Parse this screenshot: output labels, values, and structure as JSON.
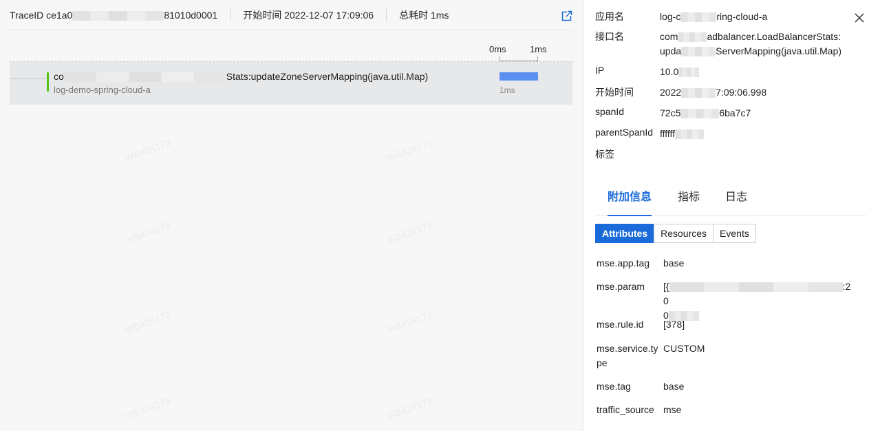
{
  "header": {
    "trace_label": "TraceID",
    "trace_prefix": "ce1a0",
    "trace_suffix": "81010d0001",
    "start_label": "开始时间",
    "start_value": "2022-12-07 17:09:06",
    "total_label": "总耗时",
    "total_value": "1ms"
  },
  "timeline": {
    "scale_start": "0ms",
    "scale_end": "1ms",
    "span": {
      "name_prefix": "co",
      "name_suffix": "Stats:updateZoneServerMapping(java.util.Map)",
      "service": "log-demo-spring-cloud-a",
      "duration": "1ms",
      "duration_fraction": 1.0,
      "color": "#5b8ff0"
    }
  },
  "watermark": "WB424173",
  "details": {
    "app_label": "应用名",
    "app_prefix": "log-c",
    "app_suffix": "ring-cloud-a",
    "api_label": "接口名",
    "api_line1_prefix": "com",
    "api_line1_suffix": "adbalancer.LoadBalancerStats:",
    "api_line2_prefix": "upda",
    "api_line2_suffix": "ServerMapping(java.util.Map)",
    "ip_label": "IP",
    "ip_prefix": "10.0",
    "start_label": "开始时间",
    "start_prefix": "2022",
    "start_suffix": "7:09:06.998",
    "spanid_label": "spanId",
    "spanid_prefix": "72c5",
    "spanid_suffix": "6ba7c7",
    "parent_label": "parentSpanId",
    "parent_prefix": "ffffff",
    "tags_label": "标签"
  },
  "tabs": [
    {
      "label": "附加信息",
      "active": true
    },
    {
      "label": "指标",
      "active": false
    },
    {
      "label": "日志",
      "active": false
    }
  ],
  "segments": [
    {
      "label": "Attributes",
      "active": true
    },
    {
      "label": "Resources",
      "active": false
    },
    {
      "label": "Events",
      "active": false
    }
  ],
  "attributes": [
    {
      "key": "mse.app.tag",
      "value": "base"
    },
    {
      "key": "mse.param",
      "value_prefix": "[{",
      "value_mid": ":20",
      "value_line2": "0"
    },
    {
      "key": "mse.rule.id",
      "value": "[378]"
    },
    {
      "key": "mse.service.type",
      "value": "CUSTOM"
    },
    {
      "key": "mse.tag",
      "value": "base"
    },
    {
      "key": "traffic_source",
      "value": "mse"
    }
  ],
  "colors": {
    "accent": "#1a6ad9",
    "span_indicator": "#52c41a",
    "duration_bar": "#5b8ff0"
  }
}
